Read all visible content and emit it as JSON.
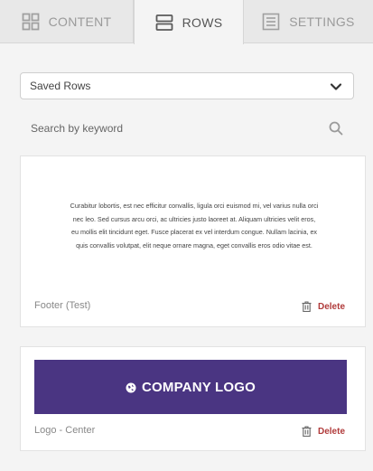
{
  "tabs": [
    {
      "label": "CONTENT",
      "icon": "grid-icon",
      "active": false
    },
    {
      "label": "ROWS",
      "icon": "rows-icon",
      "active": true
    },
    {
      "label": "SETTINGS",
      "icon": "settings-list-icon",
      "active": false
    }
  ],
  "filter": {
    "selected": "Saved Rows"
  },
  "search": {
    "placeholder": "Search by keyword"
  },
  "rows": [
    {
      "name": "Footer (Test)",
      "preview_text": "Curabitur lobortis, est nec efficitur convallis, ligula orci euismod mi, vel varius nulla orci nec leo. Sed cursus arcu orci, ac ultricies justo laoreet at. Aliquam ultricies velit eros, eu mollis elit tincidunt eget. Fusce placerat ex vel interdum congue. Nullam lacinia, ex quis convallis volutpat, elit neque ornare magna, eget convallis eros odio vitae est.",
      "delete_label": "Delete"
    },
    {
      "name": "Logo - Center",
      "logo_text": "COMPANY LOGO",
      "delete_label": "Delete"
    }
  ],
  "colors": {
    "logo_bg": "#4a3582",
    "delete": "#b03a3a",
    "tab_bar": "#e8e8e8"
  }
}
